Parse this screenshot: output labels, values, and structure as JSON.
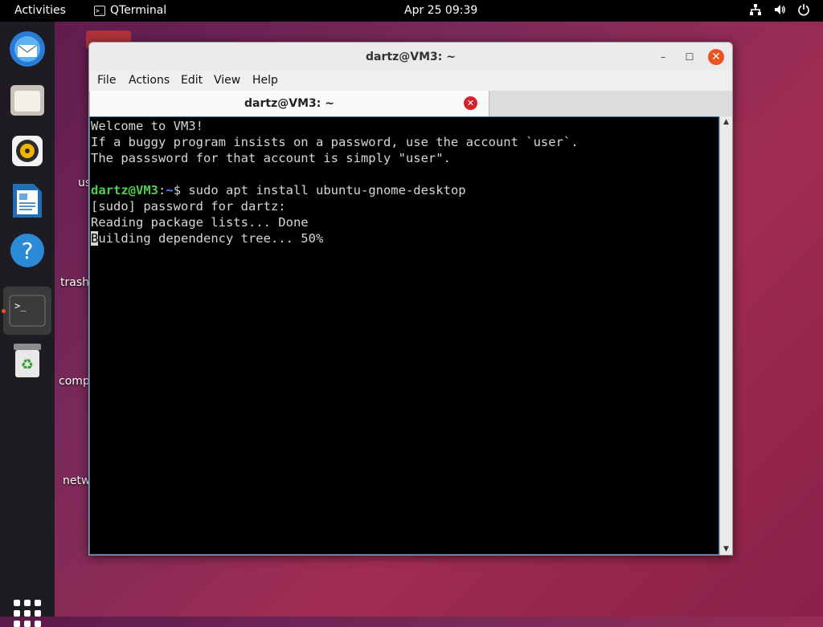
{
  "topbar": {
    "activities": "Activities",
    "app_name": "QTerminal",
    "clock": "Apr 25  09:39",
    "icons": [
      "network-icon",
      "volume-icon",
      "power-icon"
    ]
  },
  "dock": {
    "items": [
      "thunderbird-icon",
      "files-icon",
      "rhythmbox-icon",
      "writer-icon",
      "help-icon",
      "terminal-icon",
      "trash-icon"
    ],
    "active": "terminal-icon"
  },
  "desktop": {
    "labels": [
      "us",
      "trash",
      "comp",
      "netw"
    ]
  },
  "window": {
    "title": "dartz@VM3: ~",
    "menu": [
      "File",
      "Actions",
      "Edit",
      "View",
      "Help"
    ],
    "tab_title": "dartz@VM3: ~",
    "close_glyph": "✕",
    "minimize_glyph": "–",
    "maximize_glyph": "☐"
  },
  "terminal": {
    "lines": [
      "Welcome to VM3!",
      "If a buggy program insists on a password, use the account `user`.",
      "The passsword for that account is simply \"user\".",
      ""
    ],
    "prompt_user": "dartz@VM3",
    "prompt_sep": ":",
    "prompt_path": "~",
    "prompt_cmd": "$ sudo apt install ubuntu-gnome-desktop",
    "output": [
      "[sudo] password for dartz:",
      "Reading package lists... Done"
    ],
    "cursor_char": "B",
    "last_line_rest": "uilding dependency tree... 50%"
  },
  "colors": {
    "accent": "#e95420",
    "prompt_user": "#4fcf4f",
    "prompt_path": "#5a8cff"
  }
}
